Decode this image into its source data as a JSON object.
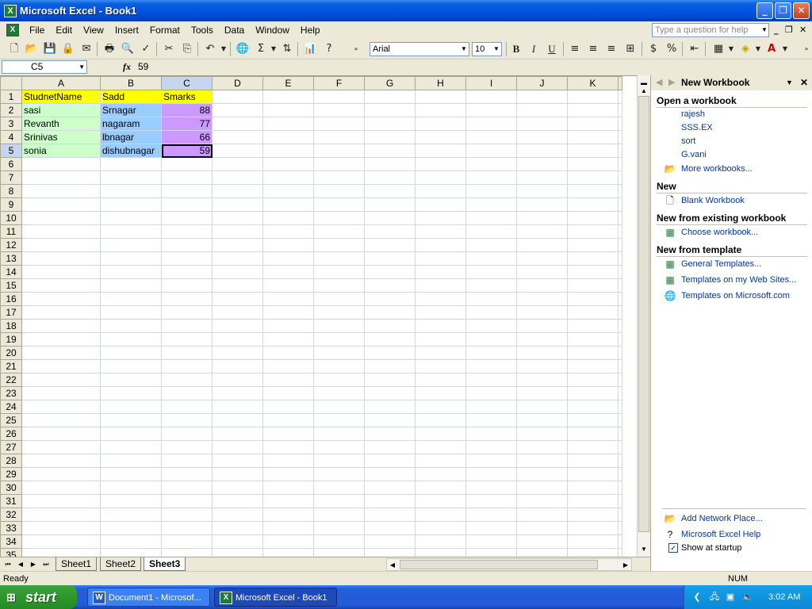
{
  "window": {
    "title": "Microsoft Excel - Book1"
  },
  "menu": [
    "File",
    "Edit",
    "View",
    "Insert",
    "Format",
    "Tools",
    "Data",
    "Window",
    "Help"
  ],
  "help_box": {
    "placeholder": "Type a question for help"
  },
  "toolbar": {
    "font_name": "Arial",
    "font_size": "10",
    "bold": "B",
    "italic": "I",
    "underline": "U"
  },
  "formula_bar": {
    "name_box": "C5",
    "fx": "fx",
    "value": "59"
  },
  "grid": {
    "columns": [
      "A",
      "B",
      "C",
      "D",
      "E",
      "F",
      "G",
      "H",
      "I",
      "J",
      "K"
    ],
    "selected_column": "C",
    "selected_row": 5,
    "rows": [
      [
        "StudnetName",
        "Sadd",
        "Smarks"
      ],
      [
        "sasi",
        "Srnagar",
        "88"
      ],
      [
        "Revanth",
        "nagaram",
        "77"
      ],
      [
        "Srinivas",
        "lbnagar",
        "66"
      ],
      [
        "sonia",
        "dishubnagar",
        "59"
      ]
    ]
  },
  "sheet_tabs": {
    "tabs": [
      "Sheet1",
      "Sheet2",
      "Sheet3"
    ],
    "active": "Sheet3"
  },
  "task_pane": {
    "title": "New Workbook",
    "sections": [
      {
        "heading": "Open a workbook",
        "links": [
          "rajesh",
          "SSS.EX",
          "sort",
          "G.vani",
          "More workbooks..."
        ]
      },
      {
        "heading": "New",
        "links": [
          "Blank Workbook"
        ]
      },
      {
        "heading": "New from existing workbook",
        "links": [
          "Choose workbook..."
        ]
      },
      {
        "heading": "New from template",
        "links": [
          "General Templates...",
          "Templates on my Web Sites...",
          "Templates on Microsoft.com"
        ]
      }
    ],
    "bottom_links": [
      "Add Network Place...",
      "Microsoft Excel Help"
    ],
    "show_at_startup": "Show at startup"
  },
  "status": {
    "text": "Ready",
    "num": "NUM"
  },
  "taskbar": {
    "start": "start",
    "tasks": [
      "Document1 - Microsof...",
      "Microsoft Excel - Book1"
    ],
    "clock": "3:02 AM"
  },
  "colors": {
    "header_yellow": "#ffff00",
    "col_a_green": "#ccffcc",
    "col_b_blue": "#99ccff",
    "col_c_purple": "#cc99ff"
  }
}
